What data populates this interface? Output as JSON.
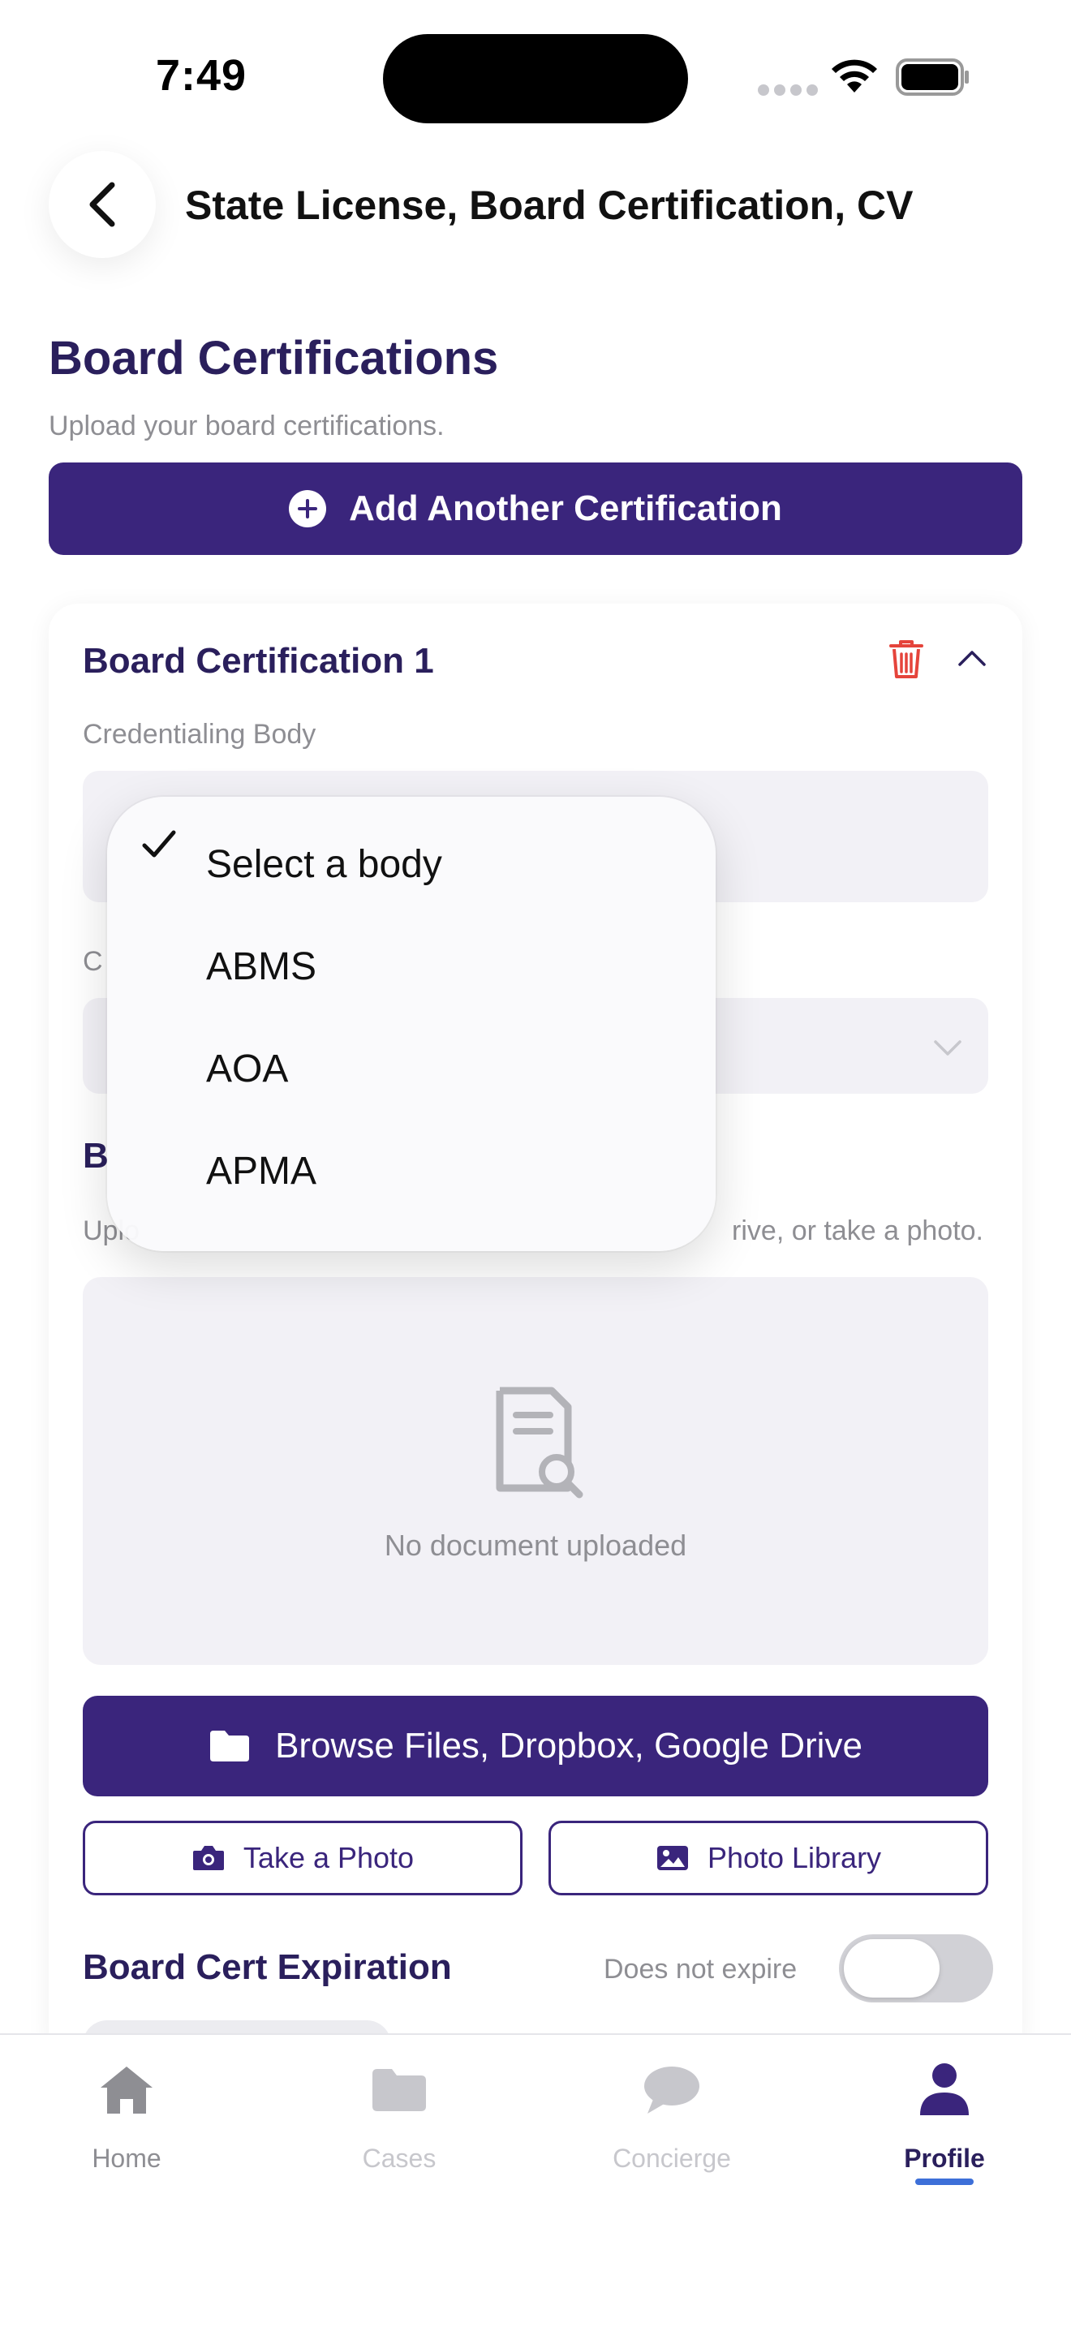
{
  "status_bar": {
    "time": "7:49"
  },
  "header": {
    "title": "State License, Board Certification, CV"
  },
  "section": {
    "title": "Board Certifications",
    "subtitle": "Upload your board certifications.",
    "add_button_label": "Add Another Certification"
  },
  "card": {
    "title": "Board Certification 1",
    "credentialing_body_label": "Credentialing Body",
    "second_field_label_fragment": "C",
    "upload_label_fragment": "B",
    "upload_sub_fragment_left": "Uplo",
    "upload_sub_fragment_right": "rive, or take a photo.",
    "no_document_text": "No document uploaded",
    "browse_button_label": "Browse Files, Dropbox, Google Drive",
    "take_photo_label": "Take a Photo",
    "photo_library_label": "Photo Library",
    "expiration_label": "Board Cert Expiration",
    "does_not_expire_label": "Does not expire",
    "does_not_expire_on": false
  },
  "dropdown": {
    "selected": "Select a body",
    "options": [
      "Select a body",
      "ABMS",
      "AOA",
      "APMA"
    ]
  },
  "tabbar": {
    "tabs": [
      {
        "label": "Home",
        "icon": "home-icon",
        "state": "inactive"
      },
      {
        "label": "Cases",
        "icon": "folder-icon",
        "state": "disabled"
      },
      {
        "label": "Concierge",
        "icon": "chat-bubble-icon",
        "state": "disabled"
      },
      {
        "label": "Profile",
        "icon": "person-icon",
        "state": "active"
      }
    ]
  },
  "colors": {
    "primary": "#3a257c",
    "title_text": "#2a1f5c",
    "muted_text": "#8e8e93",
    "danger": "#e5443b",
    "field_bg": "#f2f1f6",
    "tab_indicator": "#3d6fd8"
  }
}
